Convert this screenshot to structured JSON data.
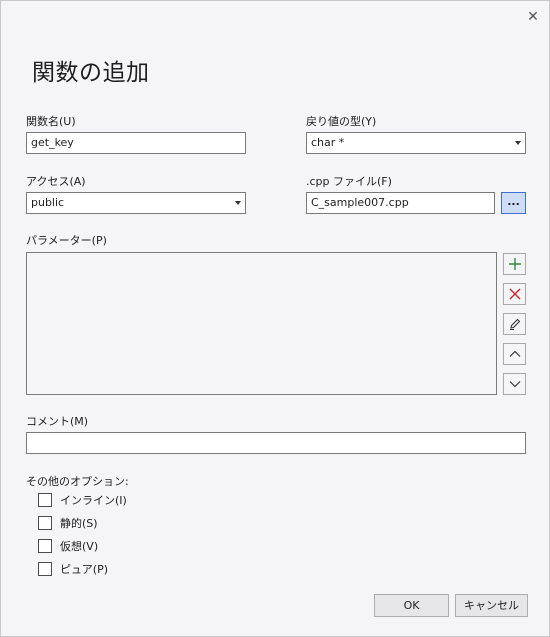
{
  "dialog": {
    "title": "関数の追加",
    "close_glyph": "✕"
  },
  "function_name": {
    "label": "関数名(U)",
    "value": "get_key"
  },
  "return_type": {
    "label": "戻り値の型(Y)",
    "value": "char *"
  },
  "access": {
    "label": "アクセス(A)",
    "value": "public"
  },
  "cpp_file": {
    "label": ".cpp ファイル(F)",
    "value": "C_sample007.cpp",
    "browse_label": "..."
  },
  "parameters": {
    "label": "パラメーター(P)",
    "tools": [
      {
        "name": "add-icon",
        "color": "#2e8b3e"
      },
      {
        "name": "delete-icon",
        "color": "#c8242c"
      },
      {
        "name": "edit-icon",
        "color": "#333333"
      },
      {
        "name": "move-up-icon",
        "color": "#333333"
      },
      {
        "name": "move-down-icon",
        "color": "#333333"
      }
    ]
  },
  "comment": {
    "label": "コメント(M)",
    "value": ""
  },
  "options": {
    "label": "その他のオプション:",
    "items": [
      {
        "label": "インライン(I)",
        "checked": false
      },
      {
        "label": "静的(S)",
        "checked": false
      },
      {
        "label": "仮想(V)",
        "checked": false
      },
      {
        "label": "ピュア(P)",
        "checked": false
      }
    ]
  },
  "buttons": {
    "ok": "OK",
    "cancel": "キャンセル"
  }
}
